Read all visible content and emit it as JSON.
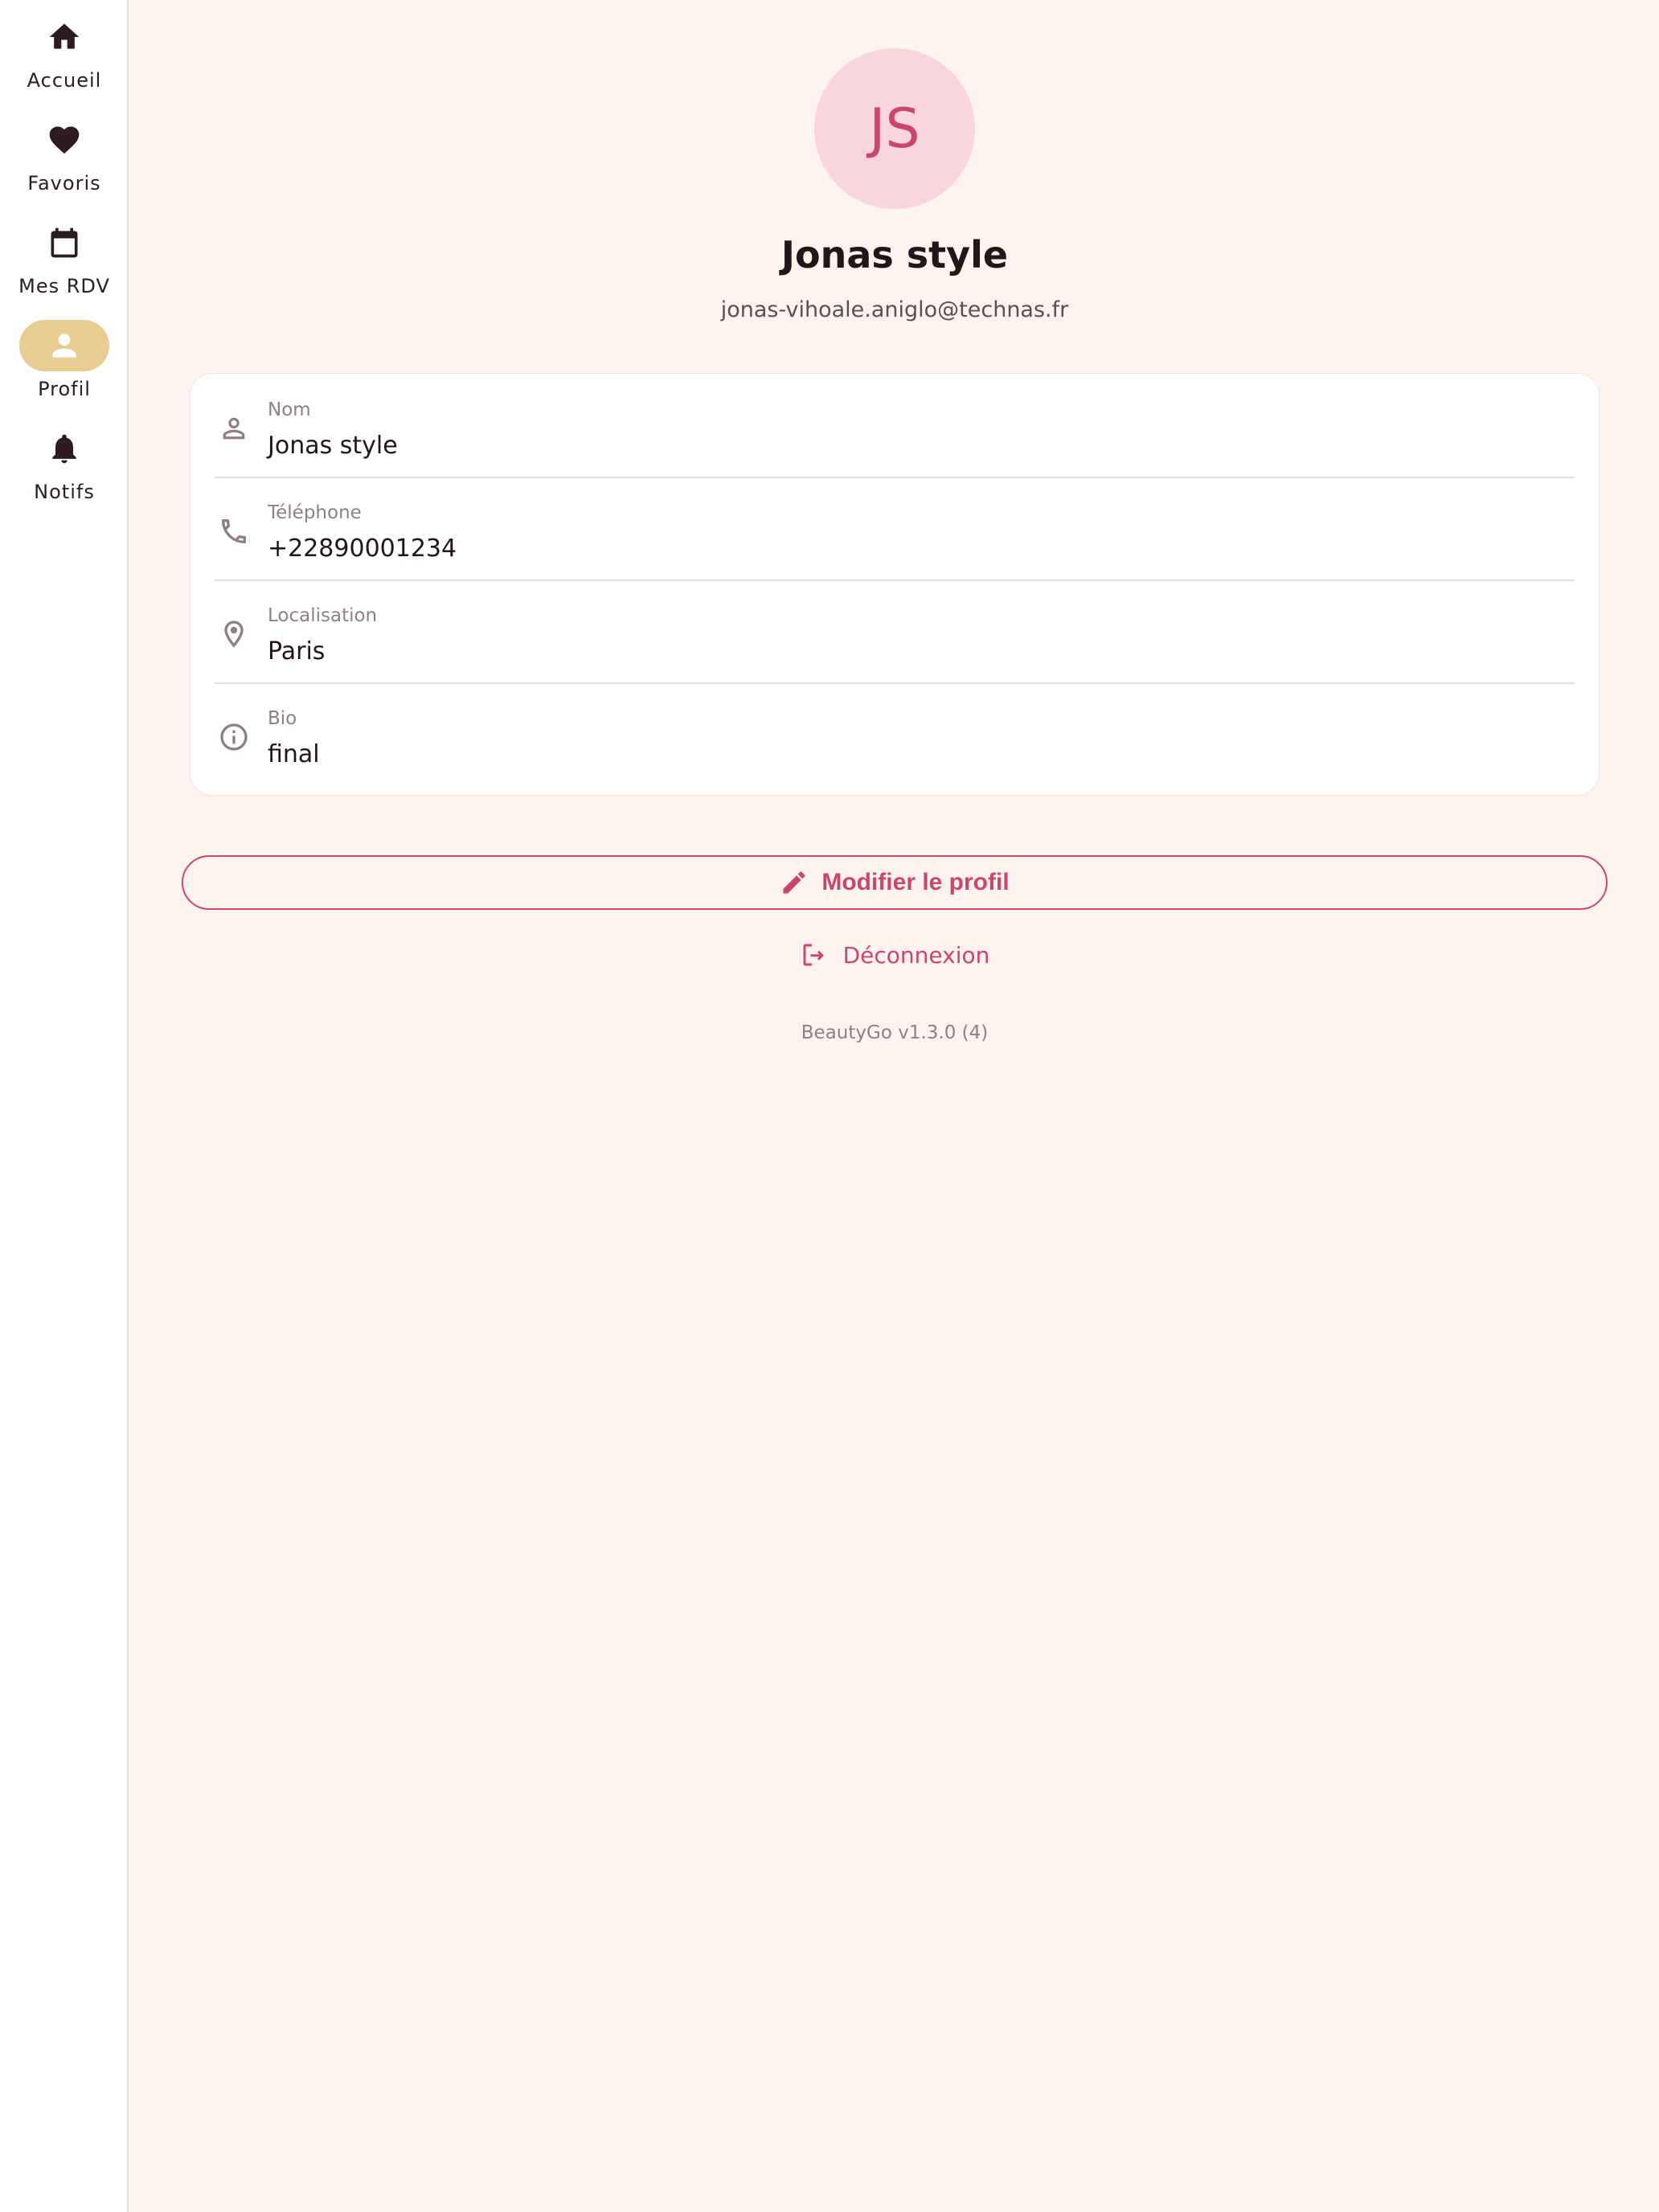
{
  "nav": {
    "items": [
      {
        "label": "Accueil",
        "icon": "home-icon"
      },
      {
        "label": "Favoris",
        "icon": "heart-icon"
      },
      {
        "label": "Mes RDV",
        "icon": "calendar-icon"
      },
      {
        "label": "Profil",
        "icon": "person-icon",
        "active": true
      },
      {
        "label": "Notifs",
        "icon": "bell-icon"
      }
    ]
  },
  "profile": {
    "initials": "JS",
    "name": "Jonas style",
    "email": "jonas-vihoale.aniglo@technas.fr"
  },
  "fields": [
    {
      "label": "Nom",
      "value": "Jonas style",
      "icon": "person-outline-icon"
    },
    {
      "label": "Téléphone",
      "value": "+22890001234",
      "icon": "phone-icon"
    },
    {
      "label": "Localisation",
      "value": "Paris",
      "icon": "location-icon"
    },
    {
      "label": "Bio",
      "value": "final",
      "icon": "info-icon"
    }
  ],
  "actions": {
    "edit_label": "Modifier le profil",
    "logout_label": "Déconnexion"
  },
  "footer": {
    "version": "BeautyGo v1.3.0 (4)"
  },
  "colors": {
    "background": "#fcf3ef",
    "accent": "#c9476f",
    "active_nav": "#e9cc91",
    "avatar_bg": "#f9d5de"
  }
}
